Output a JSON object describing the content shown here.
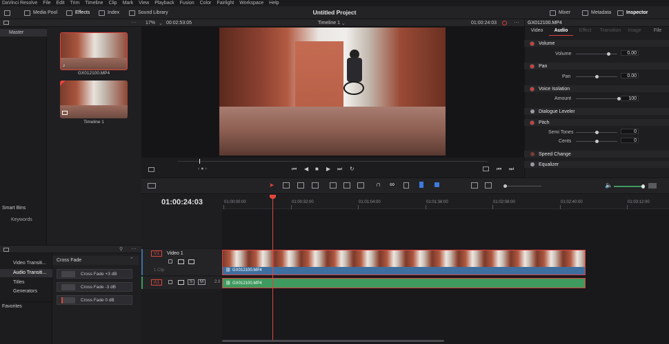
{
  "menu": [
    "DaVinci Resolve",
    "File",
    "Edit",
    "Trim",
    "Timeline",
    "Clip",
    "Mark",
    "View",
    "Playback",
    "Fusion",
    "Color",
    "Fairlight",
    "Workspace",
    "Help"
  ],
  "toolbar": {
    "media_pool": "Media Pool",
    "effects": "Effects",
    "index": "Index",
    "sound_library": "Sound Library",
    "project_title": "Untitled Project",
    "mixer": "Mixer",
    "metadata": "Metadata",
    "inspector": "Inspector"
  },
  "media_pool": {
    "bin_master": "Master",
    "smart_bins": "Smart Bins",
    "keywords": "Keywords",
    "clips": [
      {
        "name": "GX012100.MP4"
      },
      {
        "name": "Timeline 1"
      }
    ]
  },
  "viewer": {
    "zoom": "17%",
    "duration": "00:02:53:05",
    "timeline_name": "Timeline 1",
    "timecode": "01:00:24:03"
  },
  "inspector": {
    "clip_name": "GX012100.MP4",
    "tabs": [
      "Video",
      "Audio",
      "Effect",
      "Transition",
      "Image",
      "File"
    ],
    "active_tab": "Audio",
    "volume": {
      "title": "Volume",
      "label": "Volume",
      "value": "0.00"
    },
    "pan": {
      "title": "Pan",
      "label": "Pan",
      "value": "0.00"
    },
    "voice_isolation": {
      "title": "Voice Isolation",
      "label": "Amount",
      "value": "100"
    },
    "dialogue_leveler": {
      "title": "Dialogue Leveler"
    },
    "pitch": {
      "title": "Pitch",
      "semitones_label": "Semi Tones",
      "semitones": "0",
      "cents_label": "Cents",
      "cents": "0"
    },
    "speed_change": {
      "title": "Speed Change"
    },
    "equalizer": {
      "title": "Equalizer"
    }
  },
  "effects": {
    "categories": [
      "Video Transiti...",
      "Audio Transiti...",
      "Titles",
      "Generators"
    ],
    "active_category": "Audio Transiti...",
    "group_title": "Cross Fade",
    "items": [
      "Cross Fade +3 dB",
      "Cross Fade -3 dB",
      "Cross Fade 0 dB"
    ],
    "favorites": "Favorites"
  },
  "timeline": {
    "timecode": "01:00:24:03",
    "ruler": [
      "01:00:00:00",
      "01:00:32:00",
      "01:01:04:00",
      "01:01:36:00",
      "01:02:08:00",
      "01:02:40:00",
      "01:03:12:00"
    ],
    "v1": {
      "label": "V1",
      "name": "Video 1",
      "info": "1 Clip",
      "clip": "GX012100.MP4"
    },
    "a1": {
      "label": "A1",
      "level": "2.0",
      "clip": "GX012100.MP4"
    },
    "track_buttons": {
      "s": "S",
      "m": "M"
    }
  },
  "colors": {
    "accent_red": "#e0463d",
    "video_clip": "#3f6f9e",
    "audio_clip": "#3e9a5e",
    "selection": "#e04040"
  }
}
